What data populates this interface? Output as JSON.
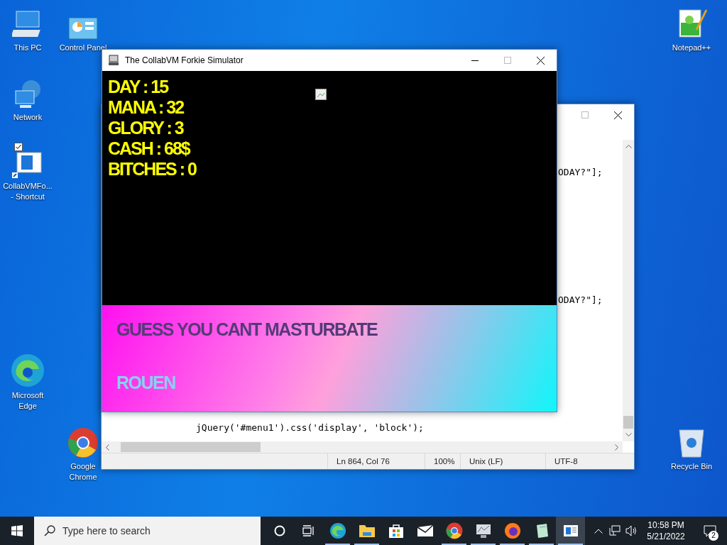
{
  "desktop_icons": [
    {
      "kind": "computer",
      "label": "This PC"
    },
    {
      "kind": "control-panel",
      "label": "Control Panel"
    },
    {
      "kind": "network",
      "label": "Network"
    },
    {
      "kind": "shortcut",
      "label": "CollabVMFo...",
      "label_2": "- Shortcut",
      "checked": true
    },
    {
      "kind": "edge",
      "label": "Microsoft",
      "label_2": "Edge"
    },
    {
      "kind": "chrome",
      "label": "Google",
      "label_2": "Chrome"
    },
    {
      "kind": "notepad",
      "label": "Notepad++"
    },
    {
      "kind": "recycle",
      "label": "Recycle Bin"
    }
  ],
  "editor_window": {
    "code_fragments": [
      "ODAY?\"];",
      "ODAY?\"];"
    ],
    "code_lines": [
      "jQuery('#menu1').css('display', 'block');"
    ],
    "status_bar": [
      "Ln 864, Col 76",
      "100%",
      "Unix (LF)",
      "UTF-8"
    ]
  },
  "game_window": {
    "title": "The CollabVM Forkie Simulator",
    "stats": [
      "DAY : 15",
      "MANA : 32",
      "GLORY : 3",
      "CASH : 68$",
      "BITCHES : 0"
    ],
    "message": "GUESS YOU CANT MASTURBATE",
    "options": [
      "ROUEN"
    ]
  },
  "taskbar": {
    "search": {
      "placeholder": "Type here to search"
    },
    "apps": [
      {
        "kind": "cortana",
        "running": false,
        "selected": false
      },
      {
        "kind": "task-view",
        "running": false,
        "selected": false
      },
      {
        "kind": "edge",
        "running": true,
        "selected": false
      },
      {
        "kind": "folder",
        "running": true,
        "selected": false
      },
      {
        "kind": "store",
        "running": false,
        "selected": false
      },
      {
        "kind": "mail",
        "running": false,
        "selected": false
      },
      {
        "kind": "chrome",
        "running": true,
        "selected": false
      },
      {
        "kind": "monitor",
        "running": true,
        "selected": false
      },
      {
        "kind": "firefox",
        "running": true,
        "selected": false
      },
      {
        "kind": "notepad",
        "running": true,
        "selected": false
      },
      {
        "kind": "window",
        "running": true,
        "selected": true
      }
    ],
    "time": "10:58 PM",
    "date": "5/21/2022",
    "notifications": "2"
  }
}
